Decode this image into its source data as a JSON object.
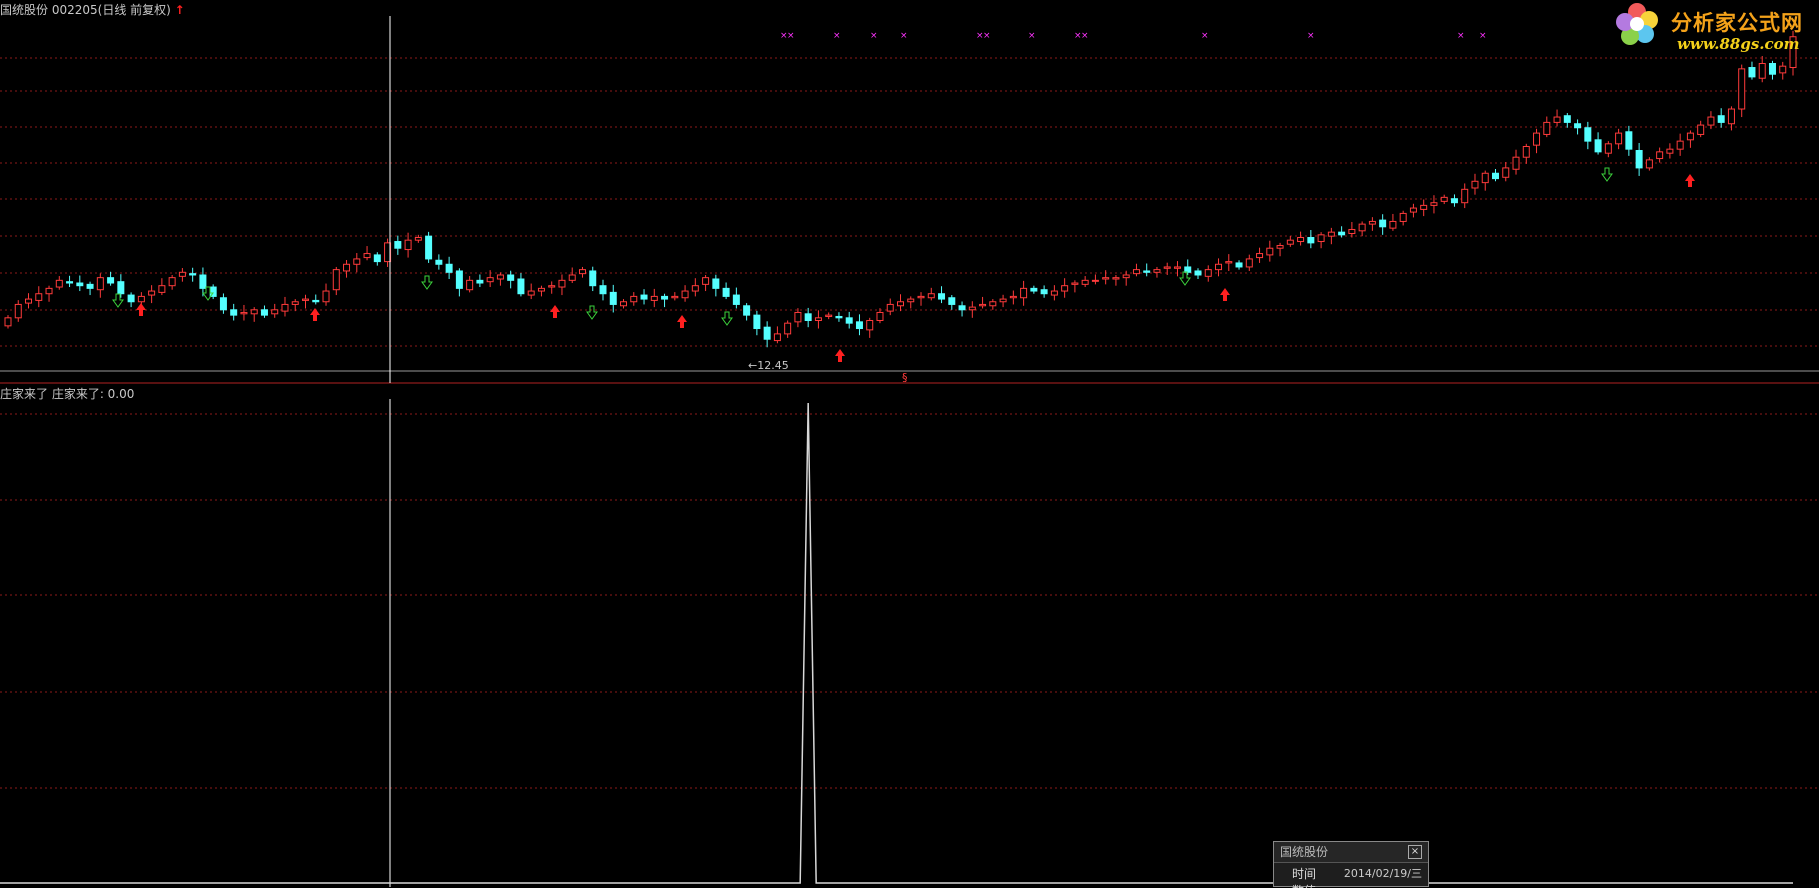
{
  "main_panel": {
    "stock_name": "国统股份",
    "stock_code": "002205",
    "mode_label": "(日线 前复权)",
    "low_price_label": "12.45",
    "section_marker": "§"
  },
  "indicator_panel": {
    "title": "庄家来了 庄家来了: 0.00"
  },
  "logo": {
    "text": "分析家公式网",
    "url": "www.88gs.com"
  },
  "info_box": {
    "title": "国统股份",
    "close": "×",
    "time_label": "时间",
    "time_value": "2014/02/19/三",
    "next_label": "数值"
  },
  "colors": {
    "up": "#ff3b3b",
    "down": "#54ffff",
    "grid": "#8b1a1a",
    "magenta_marker": "#ff33ff",
    "buy_arrow": "#ff2020",
    "sell_arrow": "#3cd23c",
    "crosshair": "#ffffff"
  },
  "chart_data": [
    {
      "type": "candlestick",
      "title": "国统股份 002205(日线 前复权)",
      "annotations": [
        "12.45"
      ],
      "closes": [
        14.0,
        14.5,
        14.7,
        14.9,
        15.1,
        15.4,
        15.3,
        15.2,
        15.1,
        15.5,
        15.3,
        14.9,
        14.6,
        14.8,
        15.0,
        15.2,
        15.5,
        15.7,
        15.6,
        15.1,
        14.8,
        14.3,
        14.1,
        14.2,
        14.3,
        14.1,
        14.3,
        14.5,
        14.6,
        14.7,
        14.6,
        15.0,
        15.8,
        16.0,
        16.2,
        16.4,
        16.1,
        16.8,
        16.6,
        16.9,
        17.0,
        16.2,
        16.0,
        15.7,
        15.1,
        15.4,
        15.3,
        15.5,
        15.6,
        15.4,
        14.9,
        15.0,
        15.1,
        15.2,
        15.4,
        15.6,
        15.8,
        15.2,
        14.9,
        14.5,
        14.6,
        14.8,
        14.7,
        14.8,
        14.7,
        14.8,
        15.0,
        15.2,
        15.5,
        15.1,
        14.8,
        14.5,
        14.1,
        13.6,
        13.2,
        13.4,
        13.8,
        14.2,
        13.9,
        14.0,
        14.1,
        14.0,
        13.8,
        13.6,
        13.9,
        14.2,
        14.5,
        14.6,
        14.7,
        14.8,
        14.9,
        14.7,
        14.5,
        14.3,
        14.4,
        14.5,
        14.6,
        14.7,
        14.8,
        15.1,
        15.0,
        14.9,
        15.0,
        15.2,
        15.3,
        15.4,
        15.4,
        15.5,
        15.5,
        15.6,
        15.8,
        15.7,
        15.8,
        15.9,
        15.9,
        15.7,
        15.6,
        15.8,
        16.0,
        16.1,
        15.9,
        16.2,
        16.4,
        16.6,
        16.7,
        16.9,
        17.0,
        16.8,
        17.1,
        17.2,
        17.1,
        17.3,
        17.5,
        17.6,
        17.4,
        17.6,
        17.9,
        18.1,
        18.2,
        18.3,
        18.5,
        18.3,
        18.8,
        19.1,
        19.4,
        19.2,
        19.6,
        20.0,
        20.4,
        20.9,
        21.3,
        21.5,
        21.3,
        21.1,
        20.6,
        20.2,
        20.5,
        20.9,
        20.3,
        19.6,
        19.9,
        20.2,
        20.3,
        20.6,
        20.9,
        21.2,
        21.5,
        21.3,
        21.8,
        23.3,
        23.0,
        23.5,
        23.1,
        23.4,
        24.5
      ]
    },
    {
      "type": "line",
      "title": "庄家来了 庄家来了: 0.00",
      "peak_index": 78,
      "values_note_free": [
        0,
        1,
        0
      ]
    }
  ]
}
